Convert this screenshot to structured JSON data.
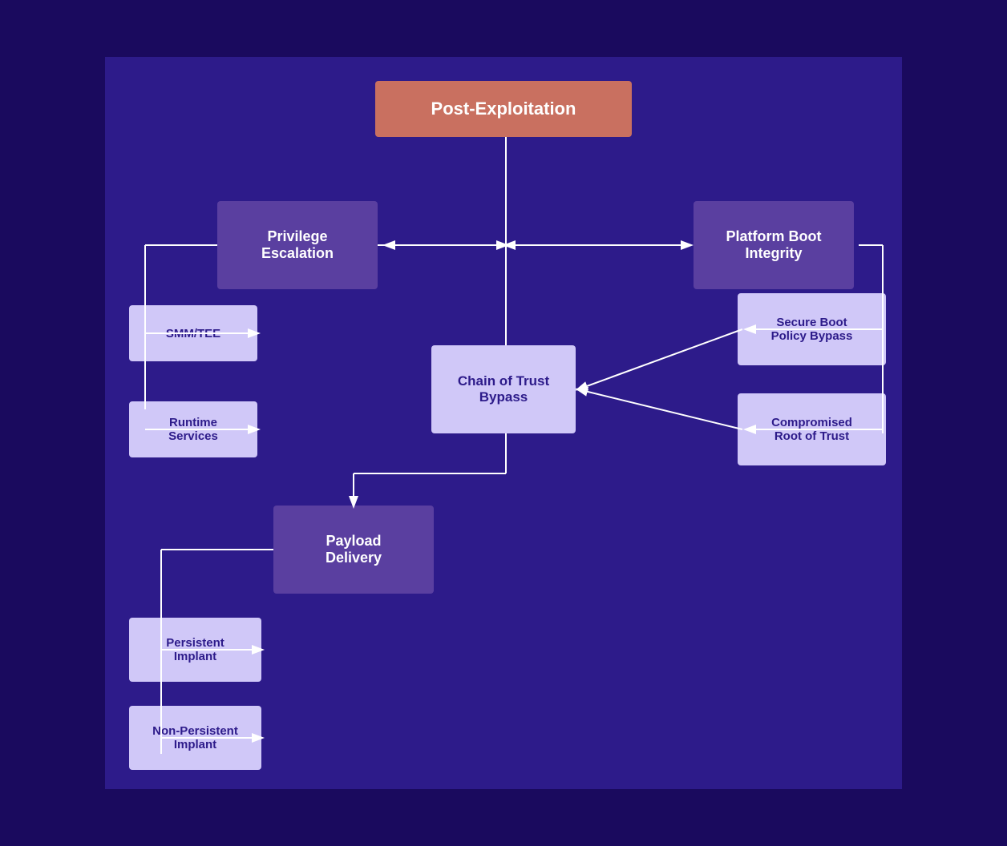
{
  "diagram": {
    "title": "Post-Exploitation",
    "nodes": {
      "root": "Post-Exploitation",
      "privilege": "Privilege\nEscalation",
      "platform": "Platform Boot\nIntegrity",
      "chain": "Chain of Trust\nBypass",
      "payload": "Payload\nDelivery",
      "smm": "SMM/TEE",
      "runtime": "Runtime\nServices",
      "secureboot": "Secure Boot\nPolicy Bypass",
      "compromised": "Compromised\nRoot of Trust",
      "persistent": "Persistent\nImplant",
      "nonpersistent": "Non-Persistent\nImplant"
    }
  }
}
